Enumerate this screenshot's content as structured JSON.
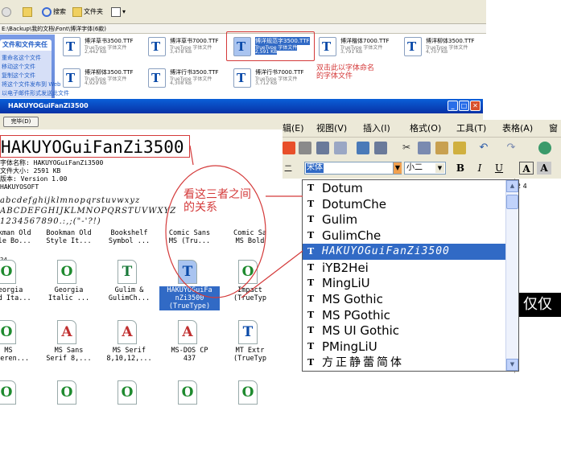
{
  "explorer": {
    "toolbar": {
      "back_label": "",
      "search_label": "搜索",
      "folders_label": "文件夹"
    },
    "address": "E:\\Backup\\我的文档\\Font\\博洋字体(6款)",
    "task_pane": {
      "header": "文件和文件夹任务",
      "items": [
        "重命名这个文件",
        "移动这个文件",
        "复制这个文件",
        "将这个文件发布到 Web",
        "以电子邮件形式发送此文件"
      ]
    },
    "files": [
      {
        "name": "博洋草书3500.TTF",
        "type": "TrueType 字体文件",
        "size": "2,442 KB"
      },
      {
        "name": "博洋草书7000.TTF",
        "type": "TrueType 字体文件",
        "size": "3,478 KB"
      },
      {
        "name": "博洋规范字3500.TTF",
        "type": "TrueType 字体文件",
        "size": "2,591 KB"
      },
      {
        "name": "博洋楷体7000.TTF",
        "type": "TrueType 字体文件",
        "size": "3,791 KB"
      },
      {
        "name": "博洋柳体3500.TTF",
        "type": "TrueType 字体文件",
        "size": "4,707 KB"
      },
      {
        "name": "博洋柳体3500.TTF",
        "type": "TrueType 字体文件",
        "size": "4,929 KB"
      },
      {
        "name": "博洋行书3500.TTF",
        "type": "TrueType 字体文件",
        "size": "4,308 KB"
      },
      {
        "name": "博洋行书7000.TTF",
        "type": "TrueType 字体文件",
        "size": "3,712 KB"
      }
    ],
    "note": "双击此以字体命名的字体文件"
  },
  "viewer": {
    "title": "HAKUYOGuiFanZi3500",
    "done_label": "完毕(D)",
    "font_name": "HAKUYOGuiFanZi3500",
    "info": "字体名称: HAKUYOGuiFanZi3500\n文件大小: 2591 KB\n版本: Version 1.00\nHAKUYOSOFT",
    "sample": "abcdefghijklmnopqrstuvwxyz\nABCDEFGHIJKLMNOPQRSTUVWXYZ\n1234567890.:,;(\"-'?!)"
  },
  "font_icons": {
    "row0": [
      {
        "label": "Bookman Old\nStyle Bo..."
      },
      {
        "label": "Bookman Old\nStyle It..."
      },
      {
        "label": "Bookshelf\nSymbol ..."
      },
      {
        "label": "Comic Sans\nMS (Tru..."
      },
      {
        "label": "Comic Sa\nMS Bold"
      }
    ],
    "row1": [
      {
        "glyph": "O",
        "color": "#1e8a2e",
        "label": "Georgia\nBold Ita..."
      },
      {
        "glyph": "O",
        "color": "#1e8a2e",
        "label": "Georgia\nItalic ..."
      },
      {
        "glyph": "T",
        "color": "#1a7a3a",
        "label": "Gulim &\nGulimCh..."
      },
      {
        "glyph": "T",
        "color": "#0a4aa8",
        "label": "HAKUYOGuiFa\nnZi3500\n(TrueType)"
      },
      {
        "glyph": "O",
        "color": "#1e8a2e",
        "label": "Impact\n(TrueTyp"
      }
    ],
    "row2": [
      {
        "glyph": "O",
        "color": "#1e8a2e",
        "label": "MS\nReferen..."
      },
      {
        "glyph": "A",
        "color": "#c03030",
        "label": "MS Sans\nSerif 8,..."
      },
      {
        "glyph": "A",
        "color": "#c03030",
        "label": "MS Serif\n8,10,12,..."
      },
      {
        "glyph": "A",
        "color": "#c03030",
        "label": "MS-DOS CP\n437"
      },
      {
        "glyph": "T",
        "color": "#0a4aa8",
        "label": "MT Extr\n(TrueTyp"
      }
    ],
    "row3": [
      {
        "glyph": "O",
        "color": "#1e8a2e"
      },
      {
        "glyph": "O",
        "color": "#1e8a2e"
      },
      {
        "glyph": "O",
        "color": "#1e8a2e"
      },
      {
        "glyph": "O",
        "color": "#1e8a2e"
      },
      {
        "glyph": "O",
        "color": "#1e8a2e"
      }
    ],
    "size_label": "24"
  },
  "word": {
    "menu": [
      "辑(E)",
      "视图(V)",
      "插入(I)",
      "格式(O)",
      "工具(T)",
      "表格(A)",
      "窗"
    ],
    "style_box": "二",
    "font_box": "宋体",
    "size_box": "小二",
    "bold": "B",
    "italic": "I",
    "underline": "U",
    "font_color": "A",
    "ruler": "2   4",
    "doc_text": "仅仅"
  },
  "dropdown": {
    "items": [
      "Dotum",
      "DotumChe",
      "Gulim",
      "GulimChe",
      "HAKUYOGuiFanZi3500",
      "iYB2Hei",
      "MingLiU",
      "MS Gothic",
      "MS PGothic",
      "MS UI Gothic",
      "PMingLiU",
      "方正静蕾简体"
    ],
    "selected_index": 4
  },
  "annotation": "看这三者之间\n的关系",
  "colors": {
    "annotation_red": "#d43a3a",
    "selection_blue": "#316ac5",
    "title_blue": "#0a5fd8"
  }
}
